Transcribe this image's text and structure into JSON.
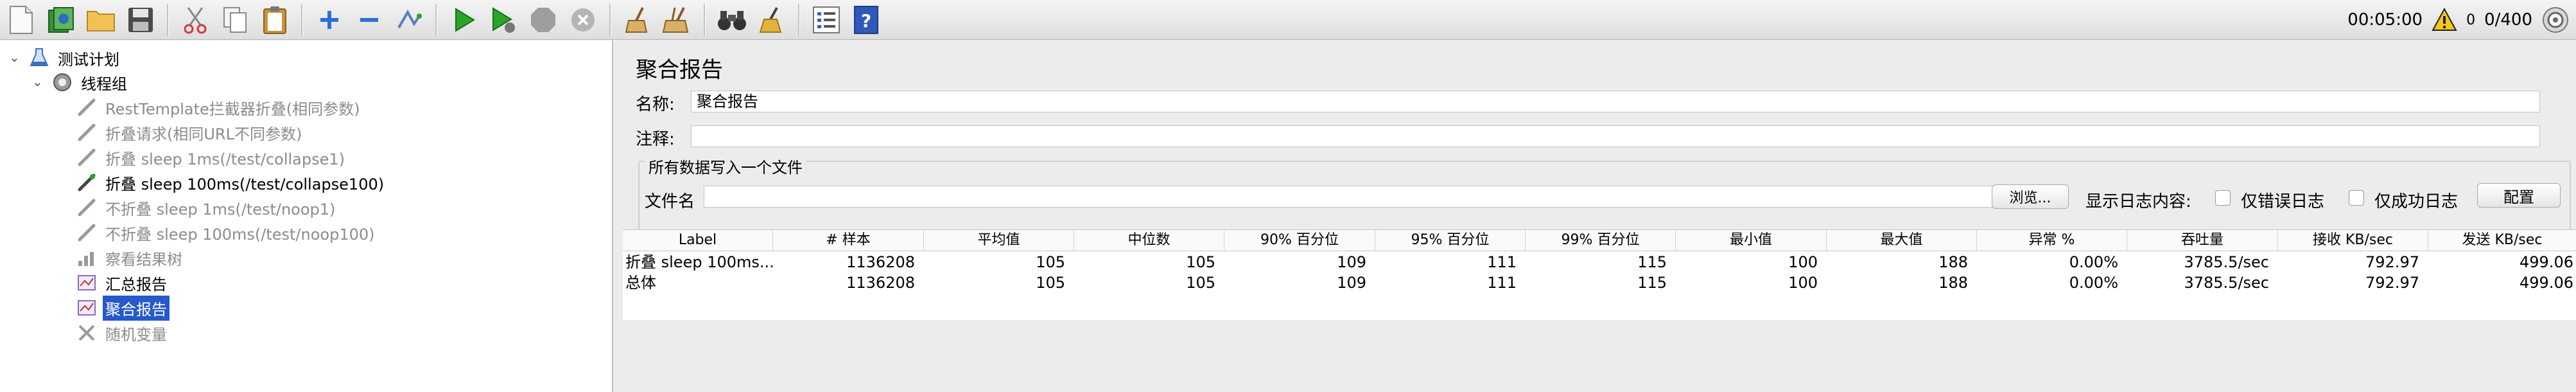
{
  "toolbar": {
    "buttons": [
      {
        "name": "new-button",
        "icon": "new-file-icon",
        "color": "#f0f0f0"
      },
      {
        "name": "templates-button",
        "icon": "templates-icon",
        "color": "#3a8f3a"
      },
      {
        "name": "open-button",
        "icon": "folder-icon",
        "color": "#e8b341"
      },
      {
        "name": "save-button",
        "icon": "save-icon",
        "color": "#4b4b4b"
      },
      {
        "name": "cut-button",
        "icon": "scissors-icon",
        "color": "#d23b3b"
      },
      {
        "name": "copy-button",
        "icon": "copy-icon",
        "color": "#bdbdbd"
      },
      {
        "name": "paste-button",
        "icon": "clipboard-icon",
        "color": "#c9953a"
      },
      {
        "name": "expand-button",
        "icon": "plus-icon",
        "color": "#2f6fd1"
      },
      {
        "name": "collapse-button",
        "icon": "minus-icon",
        "color": "#2f6fd1"
      },
      {
        "name": "toggle-button",
        "icon": "toggle-icon",
        "color": "#5a7ebf"
      },
      {
        "name": "start-button",
        "icon": "play-icon",
        "color": "#2aa52a"
      },
      {
        "name": "start-no-pause-button",
        "icon": "play-no-timers-icon",
        "color": "#2aa52a"
      },
      {
        "name": "stop-button",
        "icon": "stop-icon",
        "color": "#9e9e9e"
      },
      {
        "name": "shutdown-button",
        "icon": "shutdown-icon",
        "color": "#b5b5b5"
      },
      {
        "name": "clear-button",
        "icon": "broom-icon",
        "color": "#a27a4a"
      },
      {
        "name": "clear-all-button",
        "icon": "broom-all-icon",
        "color": "#a27a4a"
      },
      {
        "name": "search-button",
        "icon": "binoculars-icon",
        "color": "#333333"
      },
      {
        "name": "reset-search-button",
        "icon": "brush-icon",
        "color": "#e2b23c"
      },
      {
        "name": "function-helper-button",
        "icon": "list-icon",
        "color": "#3a5fa8"
      },
      {
        "name": "help-button",
        "icon": "help-icon",
        "color": "#2f58b8"
      }
    ],
    "timer": "00:05:00",
    "warning_count": "0",
    "threads": "0/400"
  },
  "tree": {
    "nodes": [
      {
        "label": "测试计划",
        "icon": "test-plan-icon",
        "state": "normal",
        "level": 0
      },
      {
        "label": "线程组",
        "icon": "thread-group-icon",
        "state": "normal",
        "level": 1
      },
      {
        "label": "RestTemplate拦截器折叠(相同参数)",
        "icon": "sampler-icon",
        "state": "disabled",
        "level": 2
      },
      {
        "label": "折叠请求(相同URL不同参数)",
        "icon": "sampler-icon",
        "state": "disabled",
        "level": 2
      },
      {
        "label": "折叠 sleep 1ms(/test/collapse1)",
        "icon": "sampler-icon",
        "state": "disabled",
        "level": 2
      },
      {
        "label": "折叠 sleep 100ms(/test/collapse100)",
        "icon": "sampler-icon",
        "state": "normal",
        "level": 2
      },
      {
        "label": "不折叠 sleep 1ms(/test/noop1)",
        "icon": "sampler-icon",
        "state": "disabled",
        "level": 2
      },
      {
        "label": "不折叠 sleep 100ms(/test/noop100)",
        "icon": "sampler-icon",
        "state": "disabled",
        "level": 2
      },
      {
        "label": "察看结果树",
        "icon": "listener-icon",
        "state": "disabled",
        "level": 2
      },
      {
        "label": "汇总报告",
        "icon": "listener-icon",
        "state": "normal",
        "level": 2
      },
      {
        "label": "聚合报告",
        "icon": "listener-icon",
        "state": "selected",
        "level": 2
      },
      {
        "label": "随机变量",
        "icon": "config-icon",
        "state": "disabled",
        "level": 2
      }
    ]
  },
  "panel": {
    "title": "聚合报告",
    "name_label": "名称:",
    "name_value": "聚合报告",
    "comment_label": "注释:",
    "comment_value": "",
    "fieldset_legend": "所有数据写入一个文件",
    "filename_label": "文件名",
    "filename_value": "",
    "browse_button": "浏览...",
    "log_content_label": "显示日志内容:",
    "errors_only_label": "仅错误日志",
    "success_only_label": "仅成功日志",
    "configure_button": "配置"
  },
  "table": {
    "columns": [
      "Label",
      "# 样本",
      "平均值",
      "中位数",
      "90% 百分位",
      "95% 百分位",
      "99% 百分位",
      "最小值",
      "最大值",
      "异常 %",
      "吞吐量",
      "接收 KB/sec",
      "发送 KB/sec"
    ],
    "rows": [
      [
        "折叠 sleep 100ms...",
        "1136208",
        "105",
        "105",
        "109",
        "111",
        "115",
        "100",
        "188",
        "0.00%",
        "3785.5/sec",
        "792.97",
        "499.06"
      ],
      [
        "总体",
        "1136208",
        "105",
        "105",
        "109",
        "111",
        "115",
        "100",
        "188",
        "0.00%",
        "3785.5/sec",
        "792.97",
        "499.06"
      ]
    ]
  }
}
